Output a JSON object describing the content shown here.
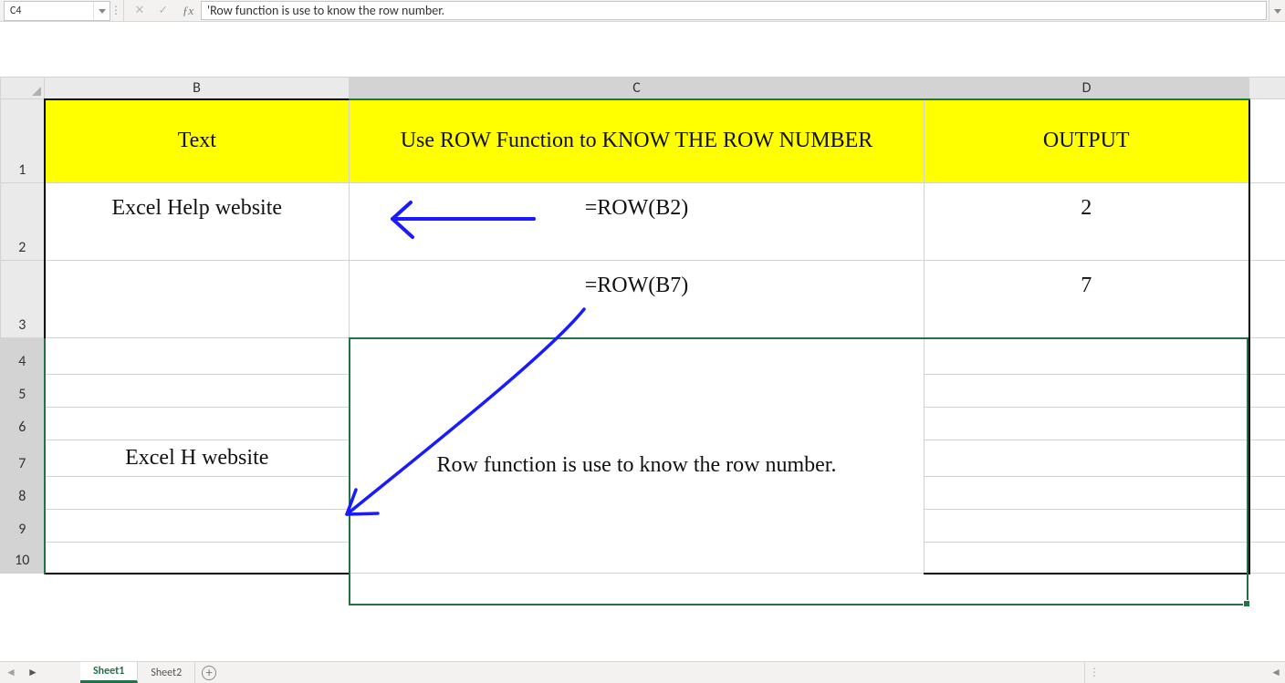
{
  "formula_bar": {
    "name_box": "C4",
    "formula": "'Row function is use to know the row number."
  },
  "columns": {
    "B": {
      "label": "B"
    },
    "C": {
      "label": "C"
    },
    "D": {
      "label": "D"
    }
  },
  "rows": [
    "1",
    "2",
    "3",
    "4",
    "5",
    "6",
    "7",
    "8",
    "9",
    "10"
  ],
  "headers": {
    "B": "Text",
    "C": "Use ROW Function to KNOW THE ROW NUMBER",
    "D": "OUTPUT"
  },
  "cells": {
    "B2": "Excel Help website",
    "C2": "=ROW(B2)",
    "D2": "2",
    "C3": "=ROW(B7)",
    "D3": "7",
    "C4": "Row function is use to know the row number.",
    "B7": "Excel H website"
  },
  "tabs": {
    "active": "Sheet1",
    "list": [
      "Sheet1",
      "Sheet2"
    ]
  },
  "selection": {
    "active_cell": "C4",
    "range": "C4:D10"
  }
}
